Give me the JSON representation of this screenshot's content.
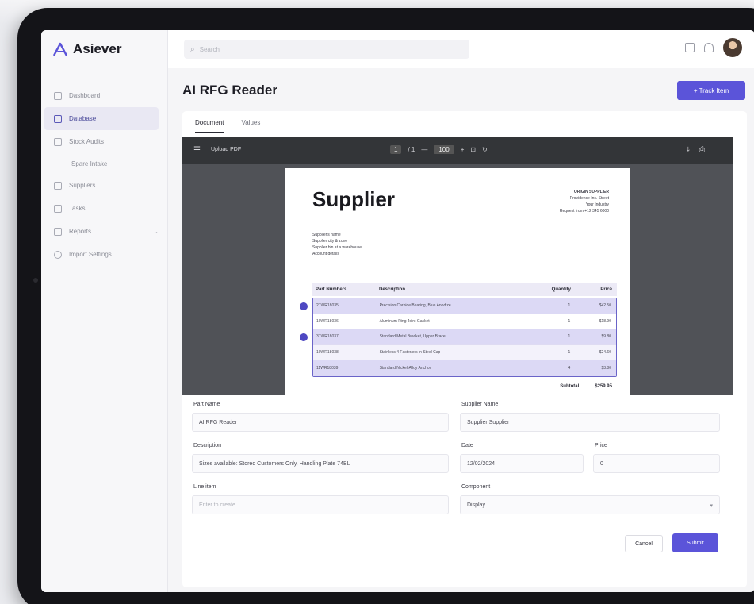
{
  "app": {
    "name": "Asiever",
    "accent_color": "#5b54d9"
  },
  "sidebar": {
    "items": [
      {
        "label": "Dashboard",
        "icon": "dashboard-icon"
      },
      {
        "label": "Database",
        "icon": "database-icon",
        "active": true
      },
      {
        "label": "Stock Audits",
        "icon": "audit-icon"
      },
      {
        "label": "Spare Intake",
        "sub": true
      },
      {
        "label": "Suppliers",
        "icon": "suppliers-icon"
      },
      {
        "label": "Tasks",
        "icon": "tasks-icon"
      },
      {
        "label": "Reports",
        "icon": "reports-icon",
        "caret": "⌄"
      },
      {
        "label": "Import Settings",
        "icon": "settings-icon"
      }
    ]
  },
  "topbar": {
    "search_placeholder": "Search",
    "icons": [
      "grid-icon",
      "bell-icon"
    ]
  },
  "main": {
    "title": "AI RFG Reader",
    "primary_action": "+ Track Item",
    "tabs": [
      {
        "label": "Document",
        "active": true
      },
      {
        "label": "Values",
        "active": false
      }
    ]
  },
  "viewer": {
    "file_name": "Upload PDF",
    "page_current": "1",
    "page_total": "/ 1",
    "zoom_minus": "—",
    "zoom": "100",
    "zoom_plus": "+"
  },
  "document": {
    "title": "Supplier",
    "address": [
      "ORIGIN SUPPLIER",
      "Providence Inc. Street",
      "Your Industry",
      "Request from +12 345 6000"
    ],
    "from": [
      "Supplier's name",
      "Supplier city & zone",
      "Supplier bin at a warehouse",
      "Account details"
    ],
    "table": {
      "headers": [
        "Part Numbers",
        "Description",
        "Quantity",
        "Price"
      ],
      "rows": [
        {
          "part": "21WR18035",
          "desc": "Precision Carbide Bearing, Blue Anodize",
          "qty": "1",
          "price": "$42.50",
          "style": "hl",
          "marker": true
        },
        {
          "part": "10WR18036",
          "desc": "Aluminum Ring Joint Gasket",
          "qty": "1",
          "price": "$18.90",
          "style": "plain",
          "marker": false
        },
        {
          "part": "31WR18037",
          "desc": "Standard Metal Bracket, Upper Brace",
          "qty": "1",
          "price": "$9.80",
          "style": "hl",
          "marker": true
        },
        {
          "part": "10WR18038",
          "desc": "Stainless 4 Fasteners in Steel Cap",
          "qty": "1",
          "price": "$24.60",
          "style": "mid",
          "marker": false
        },
        {
          "part": "11WR18039",
          "desc": "Standard Nickel-Alloy Anchor",
          "qty": "4",
          "price": "$3.80",
          "style": "hl",
          "marker": false
        }
      ]
    },
    "subtotal_label": "Subtotal",
    "subtotal_value": "$259.95"
  },
  "form": {
    "part_name": {
      "label": "Part Name",
      "value": "AI RFG Reader"
    },
    "supplier_name": {
      "label": "Supplier Name",
      "value": "Supplier Supplier"
    },
    "description": {
      "label": "Description",
      "value": "Sizes available: Stored Customers Only, Handling Plate 74BL"
    },
    "date": {
      "label": "Date",
      "value": "12/02/2024"
    },
    "price": {
      "label": "Price",
      "value": "0"
    },
    "line_item": {
      "label": "Line item",
      "placeholder": "Enter to create"
    },
    "component": {
      "label": "Component",
      "value": "Display"
    },
    "cancel_label": "Cancel",
    "submit_label": "Submit"
  }
}
